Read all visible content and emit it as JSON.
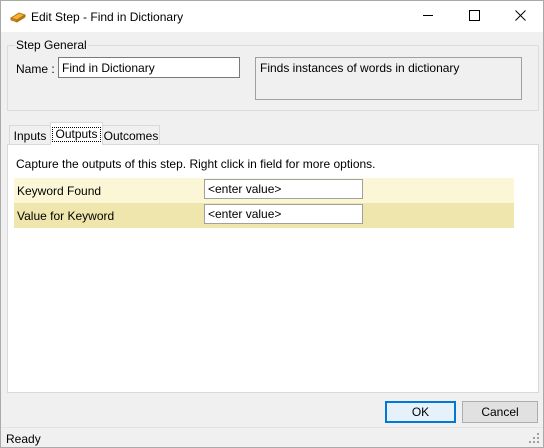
{
  "window": {
    "title": "Edit Step - Find in Dictionary"
  },
  "step_general": {
    "group_title": "Step General",
    "name_label": "Name :",
    "name_value": "Find in Dictionary",
    "description": "Finds instances of words in dictionary"
  },
  "tabs": [
    {
      "label": "Inputs",
      "selected": false
    },
    {
      "label": "Outputs",
      "selected": true
    },
    {
      "label": "Outcomes",
      "selected": false
    }
  ],
  "outputs": {
    "instruction": "Capture the outputs of this step.  Right click in field for more options.",
    "rows": [
      {
        "label": "Keyword Found",
        "value": "<enter value>"
      },
      {
        "label": "Value for Keyword",
        "value": "<enter value>"
      }
    ]
  },
  "buttons": {
    "ok": "OK",
    "cancel": "Cancel"
  },
  "status": {
    "text": "Ready"
  },
  "colors": {
    "row_light": "#fbf7d6",
    "row_dark": "#eee6ad",
    "focus_accent": "#0078d7"
  }
}
